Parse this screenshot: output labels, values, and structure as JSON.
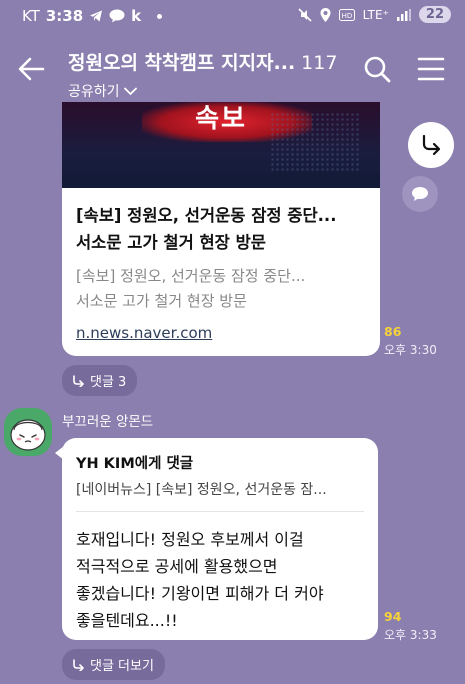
{
  "status": {
    "carrier": "KT",
    "time": "3:38",
    "lte": "LTE⁺",
    "battery": "22"
  },
  "header": {
    "title": "정원오의 착착캠프 지지자...",
    "member_count": "117",
    "share_label": "공유하기"
  },
  "link_card": {
    "banner_text": "속보",
    "title_line1": "[속보] 정원오, 선거운동 잠정 중단...",
    "title_line2": "서소문 고가 철거 현장 방문",
    "desc_line1": "[속보] 정원오, 선거운동 잠정 중단...",
    "desc_line2": "서소문 고가 철거 현장 방문",
    "url": "n.news.naver.com",
    "unread": "86",
    "time": "오후 3:30",
    "replies_label": "댓글 3"
  },
  "message2": {
    "sender": "부끄러운 앙몬드",
    "reply_to": "YH KIM에게 댓글",
    "quote": "[네이버뉴스] [속보] 정원오, 선거운동 잠...",
    "lines": [
      "호재입니다! 정원오 후보께서 이걸",
      "적극적으로 공세에 활용했으면",
      "좋겠습니다! 기왕이면 피해가 더 커야",
      "좋을텐데요...!!"
    ],
    "unread": "94",
    "time": "오후 3:33",
    "more_replies_label": "댓글 더보기"
  },
  "icons": {
    "back": "arrow-left-icon",
    "search": "search-icon",
    "menu": "hamburger-menu-icon",
    "share": "share-arrow-icon",
    "comment": "speech-bubble-icon",
    "reply": "reply-arrow-icon"
  }
}
